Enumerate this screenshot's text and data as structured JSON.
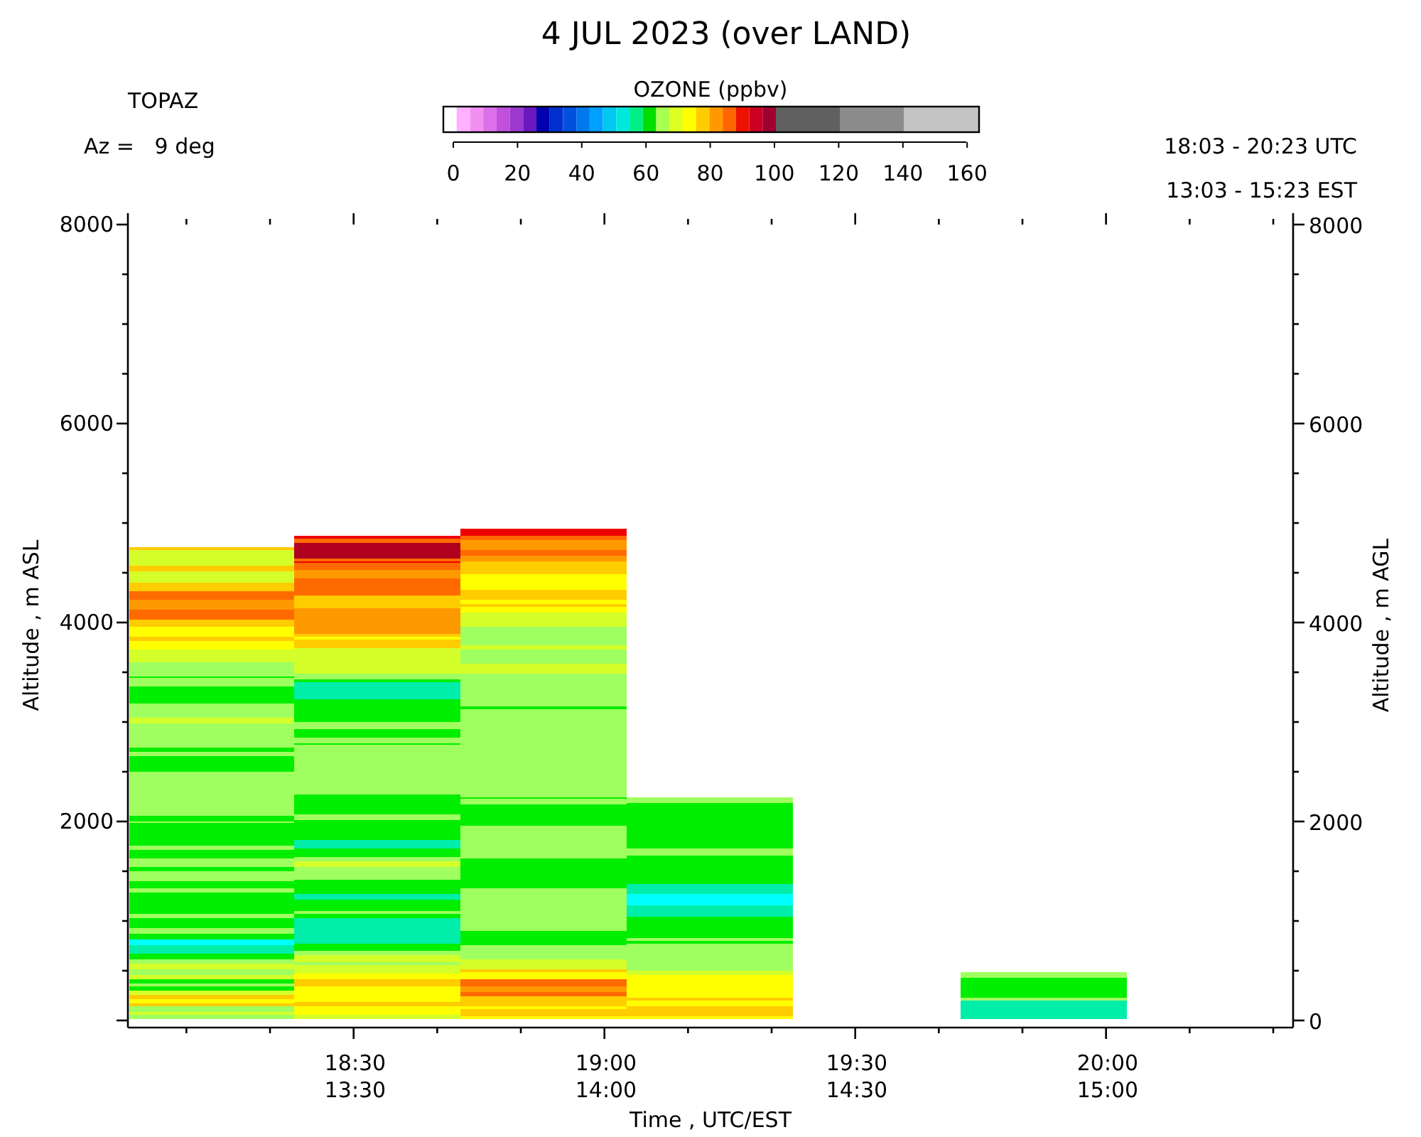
{
  "title": "4 JUL 2023 (over LAND)",
  "site": {
    "name": "TOPAZ",
    "azimuth": "Az =   9 deg"
  },
  "colorbar": {
    "title": "OZONE (ppbv)",
    "tick_labels": [
      "0",
      "20",
      "40",
      "60",
      "80",
      "100",
      "120",
      "140",
      "160"
    ]
  },
  "time_range": {
    "utc": "18:03 - 20:23 UTC",
    "est": "13:03 - 15:23 EST"
  },
  "plot": {
    "ylabel_left": "Altitude , m ASL",
    "ylabel_right": "Altitude , m AGL",
    "left_ticks": [
      "8000",
      "6000",
      "4000",
      "2000"
    ],
    "right_ticks": [
      "8000",
      "6000",
      "4000",
      "2000",
      "0"
    ],
    "x_ticks": [
      {
        "utc": "18:30",
        "est": "13:30"
      },
      {
        "utc": "19:00",
        "est": "14:00"
      },
      {
        "utc": "19:30",
        "est": "14:30"
      },
      {
        "utc": "20:00",
        "est": "15:00"
      }
    ],
    "xlabel": "Time , UTC/EST"
  }
}
